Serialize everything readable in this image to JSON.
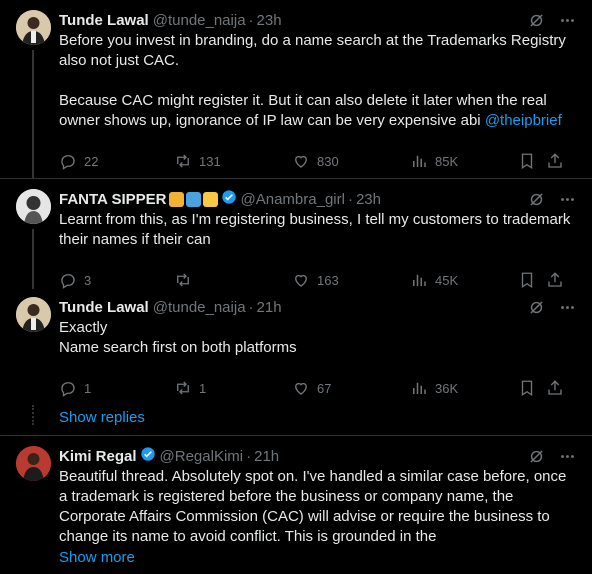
{
  "tweets": [
    {
      "name": "Tunde Lawal",
      "handle": "@tunde_naija",
      "time": "23h",
      "text": "Before you invest in branding, do a name search at the Trademarks Registry also not just CAC.\n\nBecause CAC might register it. But it can also delete it later when the real owner shows up, ignorance of IP law can be very expensive abi ",
      "mention": "@theipbrief",
      "replies": "22",
      "reposts": "131",
      "likes": "830",
      "views": "85K"
    },
    {
      "name": "FANTA SIPPER",
      "handle": "@Anambra_girl",
      "time": "23h",
      "text": "Learnt from this, as I'm registering business, I tell my customers to trademark  their names if their can",
      "replies": "3",
      "reposts": "",
      "likes": "163",
      "views": "45K"
    },
    {
      "name": "Tunde Lawal",
      "handle": "@tunde_naija",
      "time": "21h",
      "text": "Exactly\nName search first on both platforms",
      "replies": "1",
      "reposts": "1",
      "likes": "67",
      "views": "36K"
    },
    {
      "name": "Kimi Regal",
      "handle": "@RegalKimi",
      "time": "21h",
      "text": "Beautiful thread. Absolutely spot on. I've handled a similar case before, once a trademark is registered before the business or company name, the Corporate Affairs Commission (CAC) will advise or require the business to change its name to avoid conflict. This is grounded in the",
      "show_more": "Show more"
    }
  ],
  "show_replies": "Show replies",
  "colors": {
    "background": "#000000",
    "text": "#e7e9ea",
    "muted": "#71767b",
    "accent": "#1d9bf0",
    "border": "#2f3336"
  },
  "icons": [
    "grok-icon",
    "more-icon",
    "reply-icon",
    "repost-icon",
    "like-icon",
    "views-icon",
    "bookmark-icon",
    "share-icon",
    "verified-badge-icon"
  ]
}
